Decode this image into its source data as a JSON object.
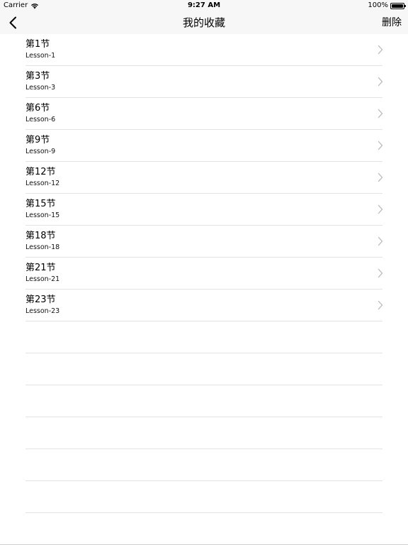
{
  "status": {
    "carrier": "Carrier",
    "time": "9:27 AM",
    "battery": "100%",
    "battery_level": 1.0
  },
  "nav": {
    "title": "我的收藏",
    "delete_label": "删除"
  },
  "items": [
    {
      "title": "第1节",
      "subtitle": "Lesson-1"
    },
    {
      "title": "第3节",
      "subtitle": "Lesson-3"
    },
    {
      "title": "第6节",
      "subtitle": "Lesson-6"
    },
    {
      "title": "第9节",
      "subtitle": "Lesson-9"
    },
    {
      "title": "第12节",
      "subtitle": "Lesson-12"
    },
    {
      "title": "第15节",
      "subtitle": "Lesson-15"
    },
    {
      "title": "第18节",
      "subtitle": "Lesson-18"
    },
    {
      "title": "第21节",
      "subtitle": "Lesson-21"
    },
    {
      "title": "第23节",
      "subtitle": "Lesson-23"
    }
  ]
}
